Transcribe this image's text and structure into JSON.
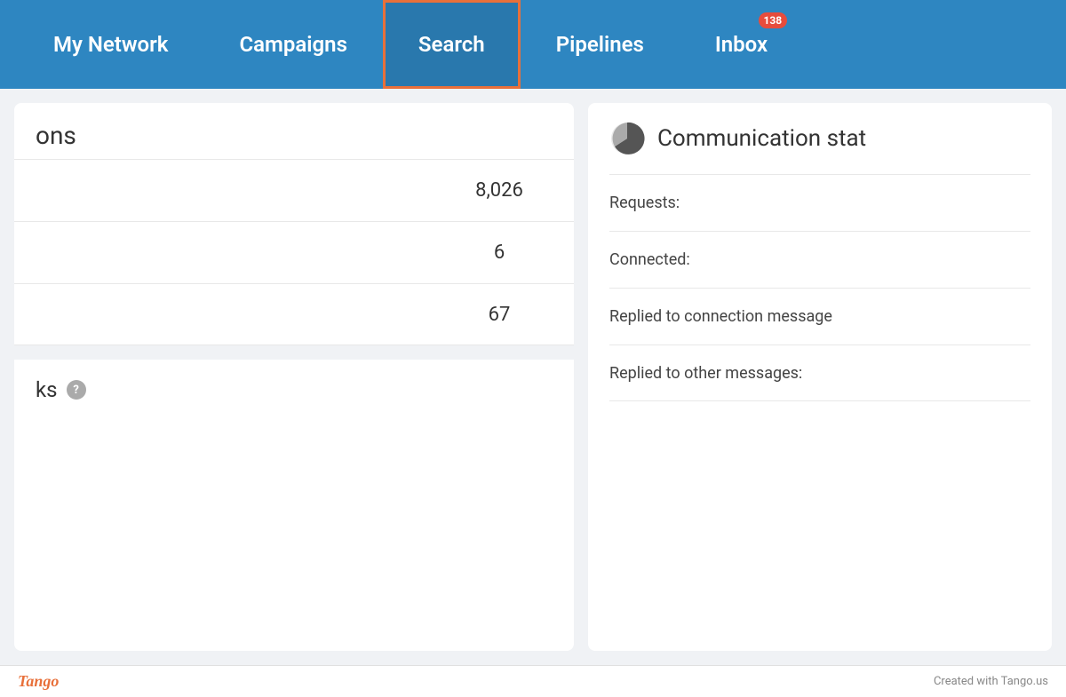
{
  "navbar": {
    "items": [
      {
        "id": "my-network",
        "label": "My Network",
        "active": false,
        "badge": null
      },
      {
        "id": "campaigns",
        "label": "Campaigns",
        "active": false,
        "badge": null
      },
      {
        "id": "search",
        "label": "Search",
        "active": true,
        "badge": null
      },
      {
        "id": "pipelines",
        "label": "Pipelines",
        "active": false,
        "badge": null
      },
      {
        "id": "inbox",
        "label": "Inbox",
        "active": false,
        "badge": "138"
      }
    ]
  },
  "left_panel": {
    "header": "ons",
    "stats": [
      {
        "label": "",
        "value": "8,026"
      },
      {
        "label": "",
        "value": "6"
      },
      {
        "label": "",
        "value": "67"
      }
    ],
    "section2_header": "ks",
    "help_tooltip": "Help"
  },
  "right_panel": {
    "title": "Communication stat",
    "rows": [
      {
        "label": "Requests:"
      },
      {
        "label": "Connected:"
      },
      {
        "label": "Replied to connection message"
      },
      {
        "label": "Replied to other messages:"
      }
    ]
  },
  "footer": {
    "logo": "Tango",
    "credit": "Created with Tango.us"
  }
}
